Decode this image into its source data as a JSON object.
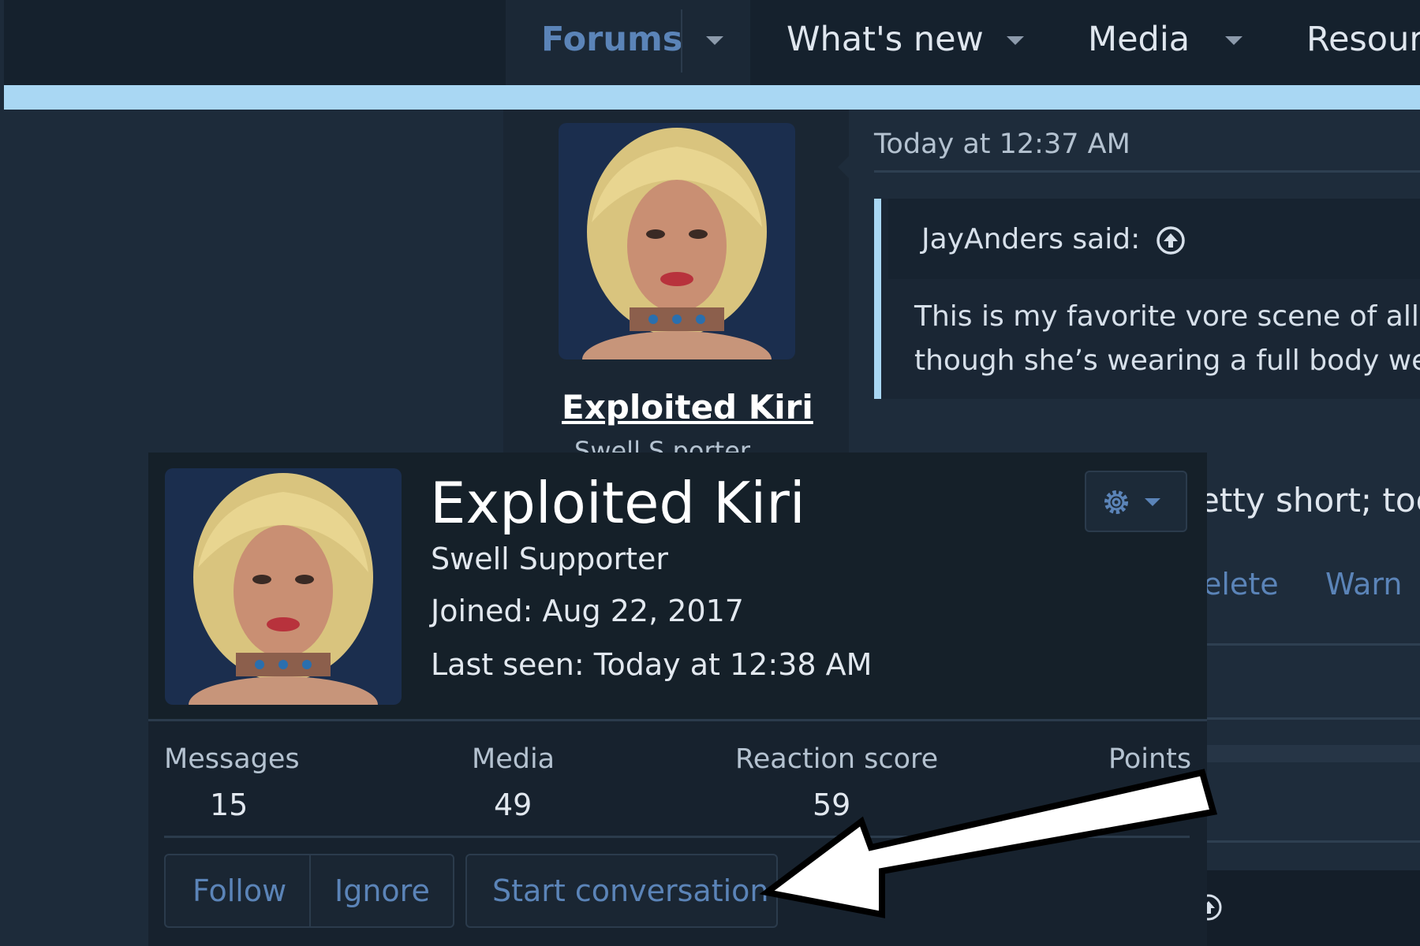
{
  "nav": {
    "items": [
      {
        "label": "Forums",
        "active": true
      },
      {
        "label": "What's new"
      },
      {
        "label": "Media"
      },
      {
        "label": "Resourc"
      }
    ]
  },
  "post": {
    "date": "Today at 12:37 AM",
    "author": "Exploited Kiri",
    "author_title_peek": "Swell S    porter",
    "quote": {
      "author_label": "JayAnders said:",
      "line1": "This is my favorite vore scene of all",
      "line2": "though she’s wearing a full body we"
    },
    "text_peek": "etty short; too",
    "actions": [
      "elete",
      "Warn"
    ]
  },
  "tooltip": {
    "name": "Exploited Kiri",
    "title": "Swell Supporter",
    "joined": "Joined: Aug 22, 2017",
    "last_seen": "Last seen: Today at 12:38 AM",
    "stats": [
      {
        "label": "Messages",
        "value": "15"
      },
      {
        "label": "Media",
        "value": "49"
      },
      {
        "label": "Reaction score",
        "value": "59"
      },
      {
        "label": "Points",
        "value": ""
      }
    ],
    "buttons": {
      "follow": "Follow",
      "ignore": "Ignore",
      "start_conversation": "Start conversation"
    }
  },
  "colors": {
    "page_bg": "#1d2b3a",
    "topbar_bg": "#15212d",
    "accent_strip": "#a9d7f3",
    "link_blue": "#5b84b8",
    "arrow_fill": "#ffffff"
  },
  "icons": [
    "chevron-down-icon",
    "arrow-up-circle-icon",
    "gear-icon",
    "callout-arrow"
  ]
}
